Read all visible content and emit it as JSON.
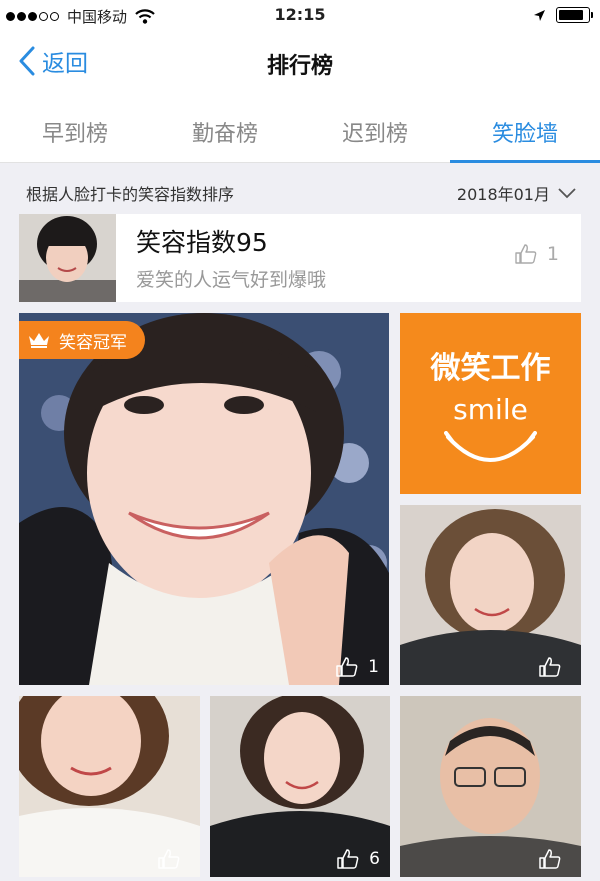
{
  "status_bar": {
    "carrier": "中国移动",
    "time": "12:15"
  },
  "nav": {
    "back_label": "返回",
    "title": "排行榜"
  },
  "tabs": [
    {
      "label": "早到榜",
      "active": false
    },
    {
      "label": "勤奋榜",
      "active": false
    },
    {
      "label": "迟到榜",
      "active": false
    },
    {
      "label": "笑脸墙",
      "active": true
    }
  ],
  "filter": {
    "description": "根据人脸打卡的笑容指数排序",
    "month": "2018年01月"
  },
  "summary": {
    "score": "笑容指数95",
    "motto": "爱笑的人运气好到爆哦",
    "likes": "1"
  },
  "grid": {
    "champion_badge": "笑容冠军",
    "champion_likes": "1",
    "brand_tile": {
      "title": "微笑工作",
      "word": "smile"
    },
    "tiles": [
      {
        "likes": ""
      },
      {
        "likes": ""
      },
      {
        "likes": "6"
      },
      {
        "likes": ""
      }
    ]
  },
  "colors": {
    "accent": "#2a8ce0",
    "orange": "#f58a1c",
    "background": "#efeff4"
  }
}
